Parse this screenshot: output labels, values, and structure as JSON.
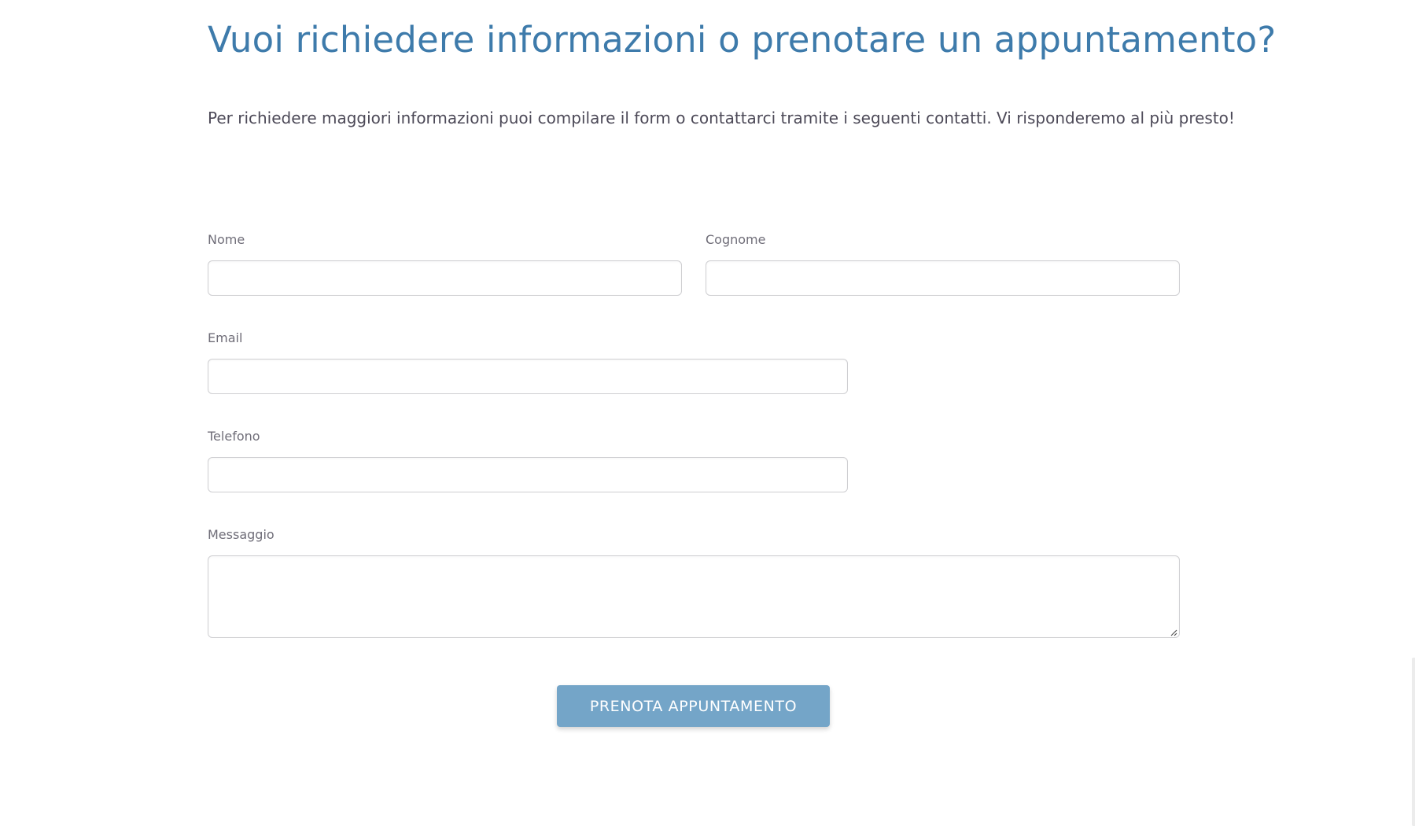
{
  "header": {
    "title": "Vuoi richiedere informazioni o prenotare un appuntamento?",
    "intro": "Per richiedere maggiori informazioni puoi compilare il form o contattarci tramite i seguenti contatti. Vi risponderemo al più presto!"
  },
  "form": {
    "nome_label": "Nome",
    "nome_value": "",
    "cognome_label": "Cognome",
    "cognome_value": "",
    "email_label": "Email",
    "email_value": "",
    "telefono_label": "Telefono",
    "telefono_value": "",
    "messaggio_label": "Messaggio",
    "messaggio_value": "",
    "submit_label": "PRENOTA APPUNTAMENTO"
  },
  "colors": {
    "accent": "#3e7bab",
    "button": "#74a5c8",
    "text": "#4d4a58",
    "border": "#cfcfd2"
  }
}
